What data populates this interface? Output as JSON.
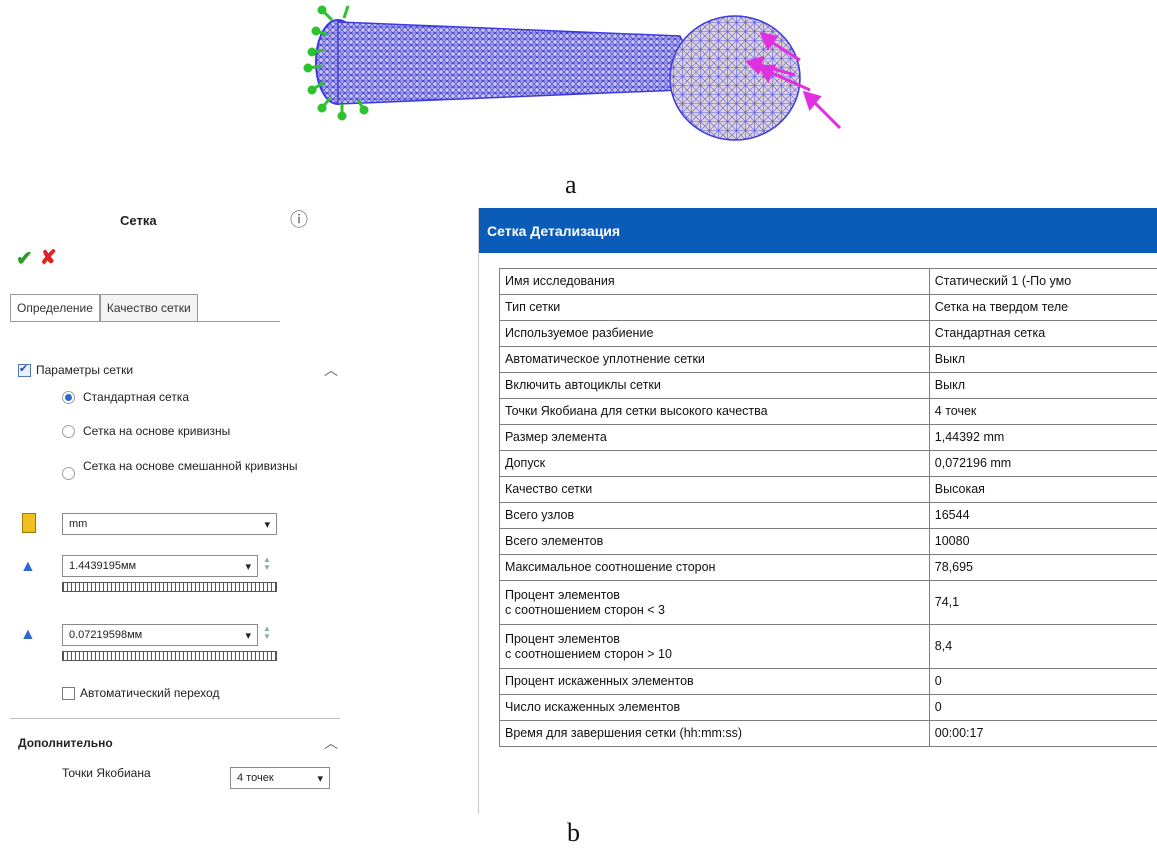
{
  "figure_a_label": "a",
  "figure_b_label": "b",
  "panel": {
    "title": "Сетка",
    "help_icon": "help-icon",
    "tabs": [
      "Определение",
      "Качество сетки"
    ],
    "mesh_params_label": "Параметры сетки",
    "radio_options": [
      "Стандартная сетка",
      "Сетка на основе кривизны",
      "Сетка на основе смешанной кривизны"
    ],
    "unit_value": "mm",
    "element_size_value": "1.4439195мм",
    "tolerance_value": "0.07219598мм",
    "auto_transition_label": "Автоматический переход",
    "additional_title": "Дополнительно",
    "jacobian_label": "Точки Якобиана",
    "jacobian_value": "4 точек"
  },
  "details": {
    "title": "Сетка Детализация",
    "rows": [
      {
        "name": "Имя исследования",
        "value": "Статический 1 (-По умо"
      },
      {
        "name": "Тип сетки",
        "value": "Сетка на твердом теле"
      },
      {
        "name": "Используемое разбиение",
        "value": "Стандартная сетка"
      },
      {
        "name": "Автоматическое уплотнение сетки",
        "value": "Выкл"
      },
      {
        "name": "Включить автоциклы сетки",
        "value": "Выкл"
      },
      {
        "name": "Точки Якобиана для сетки высокого качества",
        "value": "4 точек"
      },
      {
        "name": "Размер элемента",
        "value": "1,44392 mm"
      },
      {
        "name": "Допуск",
        "value": "0,072196 mm"
      },
      {
        "name": "Качество сетки",
        "value": "Высокая"
      },
      {
        "name": "Всего узлов",
        "value": "16544"
      },
      {
        "name": "Всего элементов",
        "value": "10080"
      },
      {
        "name": "Максимальное соотношение сторон",
        "value": "78,695"
      },
      {
        "name": "Процент элементов",
        "name2": "с соотношением сторон < 3",
        "value": "74,1"
      },
      {
        "name": "Процент элементов",
        "name2": "с соотношением сторон > 10",
        "value": "8,4"
      },
      {
        "name": "Процент искаженных элементов",
        "value": "0"
      },
      {
        "name": "Число искаженных элементов",
        "value": "0"
      },
      {
        "name": "Время для завершения сетки (hh:mm:ss)",
        "value": "00:00:17"
      }
    ]
  },
  "colors": {
    "header_blue": "#0a5cb8",
    "ok_green": "#2a9d2a",
    "cancel_red": "#d22222",
    "mesh_blue": "#3a3ae0",
    "load_magenta": "#e030e0",
    "fixture_green": "#2cc22c"
  }
}
